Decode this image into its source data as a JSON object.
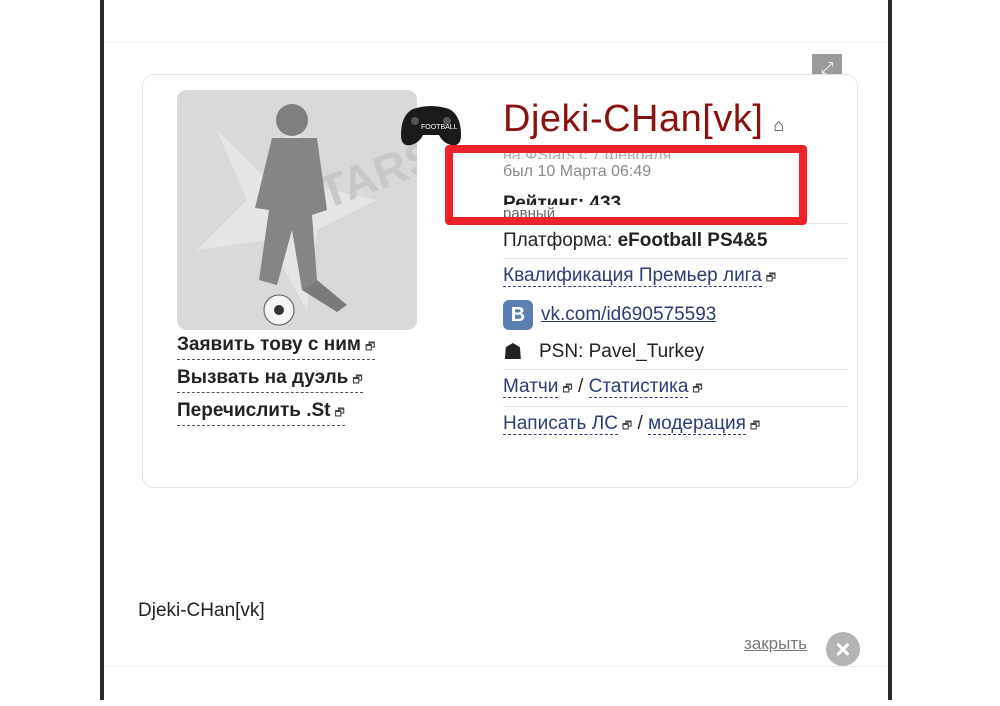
{
  "player": {
    "name": "Djeki-CHan[vk]",
    "faded_line": "на ФStars с 7 февраля",
    "last_seen": "был 10 Марта 06:49",
    "rating": "Рейтинг: 433",
    "rating_note": "равный",
    "platform_label": "Платформа: ",
    "platform_value": "eFootball PS4&5",
    "qualification": "Квалификация Премьер лига",
    "vk_link": "vk.com/id690575593",
    "psn": "PSN: Pavel_Turkey",
    "matches": "Матчи",
    "stats": "Статистика",
    "write_pm": "Написать ЛС",
    "moderation": "модерация",
    "separator": "/"
  },
  "actions": {
    "challenge": "Заявить тову с ним",
    "duel": "Вызвать на дуэль",
    "transfer": "Перечислить .St"
  },
  "footer": {
    "name": "Djeki-CHan[vk]",
    "close_label": "закрыть"
  },
  "icons": {
    "vk": "B",
    "psn": "☗",
    "home": "⌂",
    "close": "×",
    "expand": "⤢",
    "external": "🗗"
  },
  "colors": {
    "name": "#8b1010",
    "link": "#2b3d74",
    "highlight": "#ee2229"
  }
}
